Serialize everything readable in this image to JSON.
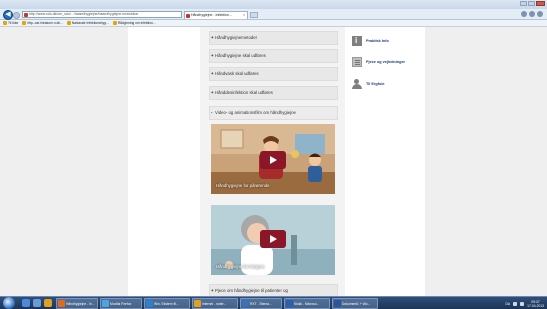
{
  "browser": {
    "address": "http://www.sdu.dk/om_sdu/.../haandhygiejne/haandhygiejne-instruktion",
    "tab_title": "Håndhygiejne - Infektion...",
    "tab_close": "×",
    "back_glyph": "◀",
    "favorites": [
      {
        "label": "Til Ikke"
      },
      {
        "label": "http--sst.intrakom.n.dk..."
      },
      {
        "label": "Nationale Infektionshyg..."
      },
      {
        "label": "Rådgivning om infektion..."
      }
    ]
  },
  "accordion": [
    {
      "sign": "+",
      "label": "Håndhygiejnemetoder"
    },
    {
      "sign": "+",
      "label": "Håndhygiejne skal udføres"
    },
    {
      "sign": "+",
      "label": "Håndvask skal udføres"
    },
    {
      "sign": "+",
      "label": "Hånddesinfektion skal udføres"
    },
    {
      "sign": "-",
      "label": "Video- og animationsfilm om håndhygiejne"
    }
  ],
  "last_item": {
    "sign": "+",
    "label": "Pjece om håndhygiejne til patienter og"
  },
  "videos": [
    {
      "caption": "Håndhygiejne for pårørende"
    },
    {
      "caption": "Håndhygiejne for borgere"
    }
  ],
  "side_links": [
    {
      "label": "Praktisk Info",
      "icon": "info-icon"
    },
    {
      "label": "Pjece og vejledninger",
      "icon": "document-icon"
    },
    {
      "label": "Til Ergfole",
      "icon": "person-icon"
    }
  ],
  "taskbar": {
    "buttons": [
      {
        "label": "Håndhygiejne - In...",
        "color": "#e06b1f"
      },
      {
        "label": "Mozilla Firefox",
        "color": "#4fa3e0"
      },
      {
        "label": "Win. Ekstern fil...",
        "color": "#2f7fd0"
      },
      {
        "label": "Internet - noter...",
        "color": "#e0a020"
      },
      {
        "label": "RXT - Stema...",
        "color": "#3c70b8"
      },
      {
        "label": "Klokk - Microso...",
        "color": "#2d5fb0"
      },
      {
        "label": "Dokument1 + Wo...",
        "color": "#2b579a"
      }
    ],
    "clock_time": "09:37",
    "clock_date": "17-04-2013",
    "language": "DA"
  },
  "colors": {
    "accent": "#8a1628",
    "link": "#1c3e7a"
  }
}
